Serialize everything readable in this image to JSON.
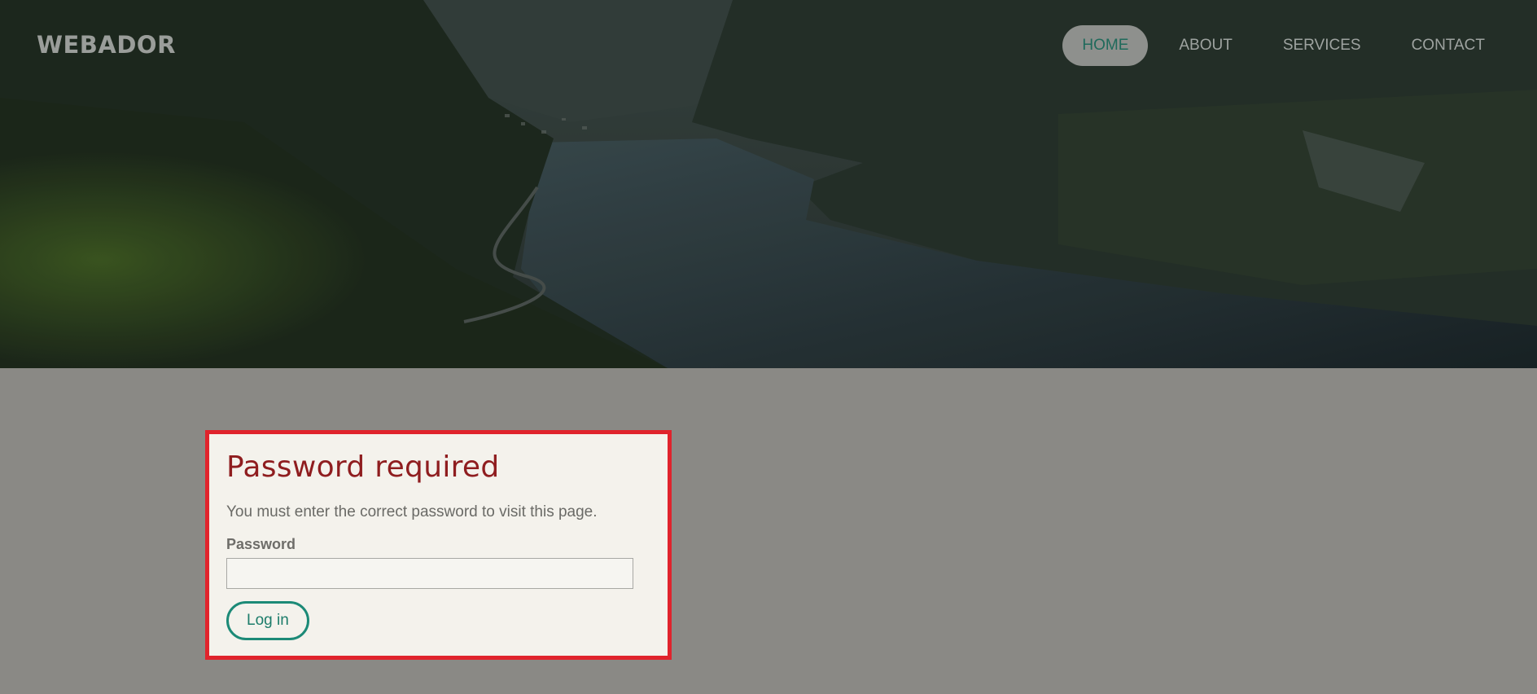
{
  "header": {
    "logo": "WEBADOR",
    "nav": [
      {
        "label": "HOME",
        "active": true
      },
      {
        "label": "ABOUT",
        "active": false
      },
      {
        "label": "SERVICES",
        "active": false
      },
      {
        "label": "CONTACT",
        "active": false
      }
    ]
  },
  "password_form": {
    "title": "Password required",
    "message": "You must enter the correct password to visit this page.",
    "field_label": "Password",
    "field_value": "",
    "submit_label": "Log in"
  },
  "colors": {
    "accent": "#1c8a77",
    "title": "#8f1d1f",
    "highlight_border": "#e0232c",
    "card_bg": "#f4f2ec",
    "page_bg": "#8a8985"
  }
}
